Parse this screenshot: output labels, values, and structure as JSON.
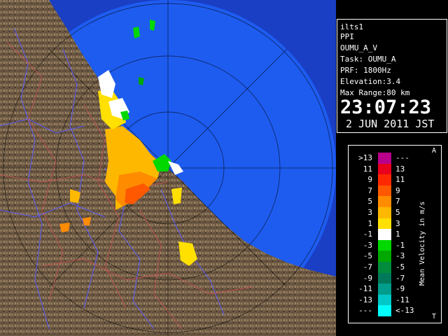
{
  "info": {
    "station": "ilts1",
    "scan_type": "PPI",
    "product": "OUMU_A_V",
    "task": "Task: OUMU_A",
    "prf": "PRF: 1800Hz",
    "elevation": "Elevation:3.4",
    "max_range": "Max Range:80 km",
    "time": "23:07:23",
    "date": "2 JUN 2011 JST"
  },
  "legend": {
    "title": "Mean Velocity in m/s",
    "corner_top": "A",
    "corner_bottom": "T",
    "bins": [
      {
        "left": ">13",
        "right": "---",
        "color": "#b8008c"
      },
      {
        "left": "11",
        "right": "13",
        "color": "#e8001c"
      },
      {
        "left": "9",
        "right": "11",
        "color": "#ff2800"
      },
      {
        "left": "7",
        "right": "9",
        "color": "#ff5800"
      },
      {
        "left": "5",
        "right": "7",
        "color": "#ff8c00"
      },
      {
        "left": "3",
        "right": "5",
        "color": "#ffb800"
      },
      {
        "left": "1",
        "right": "3",
        "color": "#ffe000"
      },
      {
        "left": "-1",
        "right": "1",
        "color": "#ffffff"
      },
      {
        "left": "-3",
        "right": "-1",
        "color": "#00d800"
      },
      {
        "left": "-5",
        "right": "-3",
        "color": "#00a800"
      },
      {
        "left": "-7",
        "right": "-5",
        "color": "#008c3c"
      },
      {
        "left": "-9",
        "right": "-7",
        "color": "#00785a"
      },
      {
        "left": "-11",
        "right": "-9",
        "color": "#009c8c"
      },
      {
        "left": "-13",
        "right": "-11",
        "color": "#00c8c8"
      },
      {
        "left": "---",
        "right": "<-13",
        "color": "#00ffff"
      }
    ]
  },
  "colors": {
    "sea": "#1e5cf0",
    "sea_outer": "#1a40c8",
    "land": "#6e5a44",
    "rivers": "#5a5aff",
    "roads": "#c05050"
  }
}
